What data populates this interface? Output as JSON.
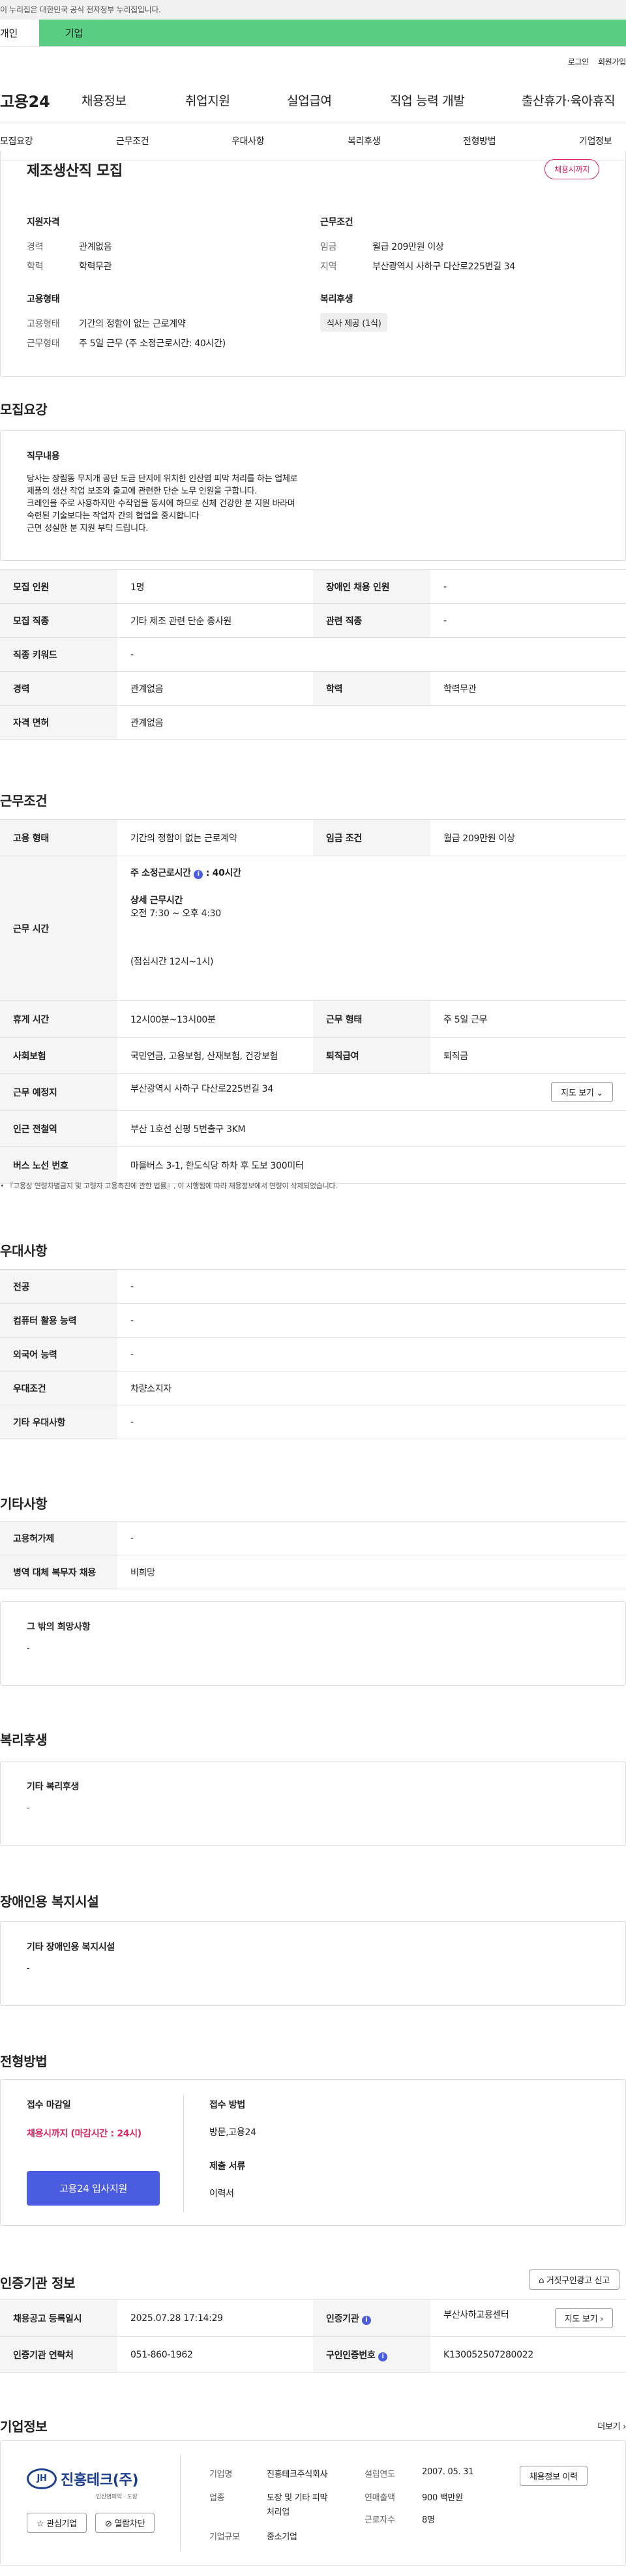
{
  "gov_banner": "이 누리집은 대한민국 공식 전자정부 누리집입니다.",
  "user_type": {
    "individual": "개인",
    "company": "기업"
  },
  "util": {
    "login": "로그인",
    "signup": "회원가입"
  },
  "logo": "고용24",
  "gnb": [
    "채용정보",
    "취업지원",
    "실업급여",
    "직업 능력 개발",
    "출산휴가·육아휴직"
  ],
  "tabs": [
    "모집요강",
    "근무조건",
    "우대사항",
    "복리후생",
    "전형방법",
    "기업정보"
  ],
  "summary": {
    "title": "제조생산직 모집",
    "badge": "채용시까지",
    "qual_title": "지원자격",
    "career_k": "경력",
    "career_v": "관계없음",
    "edu_k": "학력",
    "edu_v": "학력무관",
    "emp_title": "고용형태",
    "emp_k": "고용형태",
    "emp_v": "기간의 정함이 없는 근로계약",
    "work_k": "근무형태",
    "work_v": "주 5일 근무 (주 소정근로시간: 40시간)",
    "cond_title": "근무조건",
    "wage_k": "임금",
    "wage_v": "월급 209만원 이상",
    "region_k": "지역",
    "region_v": "부산광역시 사하구 다산로225번길 34",
    "welfare_title": "복리후생",
    "welfare_pill": "식사 제공 (1식)"
  },
  "recruit": {
    "title": "모집요강",
    "duty_title": "직무내용",
    "duty_lines": [
      "당사는 장림동 무지개 공단 도금 단지에 위치한 인산염 피막 처리를 하는 업체로",
      "제품의 생산 작업 보조와 출고에 관련한 단순 노무 인원을 구합니다.",
      "크레인을 주로 사용하지만 수작업을 동시에 하므로 신체 건강한 분 지원 바라며",
      "숙련된 기술보다는 작업자 간의 협업을 중시합니다",
      "근면 성실한 분 지원 부탁 드립니다."
    ],
    "rows": {
      "count_k": "모집 인원",
      "count_v": "1명",
      "disabled_k": "장애인 채용 인원",
      "disabled_v": "-",
      "job_k": "모집 직종",
      "job_v": "기타 제조 관련 단순 종사원",
      "related_k": "관련 직종",
      "related_v": "-",
      "keyword_k": "직종 키워드",
      "keyword_v": "-",
      "career_k": "경력",
      "career_v": "관계없음",
      "edu_k": "학력",
      "edu_v": "학력무관",
      "license_k": "자격 면허",
      "license_v": "관계없음"
    }
  },
  "conditions": {
    "title": "근무조건",
    "emp_k": "고용 형태",
    "emp_v": "기간의 정함이 없는 근로계약",
    "wage_k": "임금 조건",
    "wage_v": "월급 209만원 이상",
    "hours_k": "근무 시간",
    "hours_main": "주 소정근로시간",
    "hours_main_v": ": 40시간",
    "hours_detail_t": "상세 근무시간",
    "hours_detail_v": "오전 7:30 ~ 오후 4:30",
    "hours_break": "(점심시간 12시~1시)",
    "rest_k": "휴게 시간",
    "rest_v": "12시00분~13시00분",
    "worktype_k": "근무 형태",
    "worktype_v": "주 5일 근무",
    "insurance_k": "사회보험",
    "insurance_v": "국민연금, 고용보험, 산재보험, 건강보험",
    "severance_k": "퇴직급여",
    "severance_v": "퇴직금",
    "location_k": "근무 예정지",
    "location_v": "부산광역시 사하구 다산로225번길 34",
    "map_btn": "지도 보기",
    "subway_k": "인근 전철역",
    "subway_v": "부산 1호선 신평 5번출구 3KM",
    "bus_k": "버스 노선 번호",
    "bus_v": "마을버스 3-1, 한도식당 하차 후 도보 300미터",
    "notice": "『고용상 연령차별금지 및 고령자 고용촉진에 관한 법률』, 이 시행됨에 따라 채용정보에서 연령이 삭제되었습니다."
  },
  "preference": {
    "title": "우대사항",
    "major_k": "전공",
    "major_v": "-",
    "pc_k": "컴퓨터 활용 능력",
    "pc_v": "-",
    "lang_k": "외국어 능력",
    "lang_v": "-",
    "cond_k": "우대조건",
    "cond_v": "차량소지자",
    "etc_k": "기타 우대사항",
    "etc_v": "-"
  },
  "etc": {
    "title": "기타사항",
    "permit_k": "고용허가제",
    "permit_v": "-",
    "military_k": "병역 대체 복무자 채용",
    "military_v": "비희망",
    "other_t": "그 밖의 희망사항",
    "other_v": "-"
  },
  "welfare": {
    "title": "복리후생",
    "box_t": "기타 복리후생",
    "box_v": "-"
  },
  "disabled_fac": {
    "title": "장애인용 복지시설",
    "box_t": "기타 장애인용 복지시설",
    "box_v": "-"
  },
  "selection": {
    "title": "전형방법",
    "deadline_t": "접수 마감일",
    "deadline_v": "채용시까지 (마감시간 : 24시)",
    "apply_btn": "고용24 입사지원",
    "method_t": "접수 방법",
    "method_v": "방문,고용24",
    "docs_t": "제출 서류",
    "docs_v": "이력서"
  },
  "cert": {
    "title": "인증기관 정보",
    "report_btn": "거짓구인광고 신고",
    "reg_k": "채용공고 등록일시",
    "reg_v": "2025.07.28 17:14:29",
    "org_k": "인증기관",
    "org_v": "부산사하고용센터",
    "map_btn": "지도 보기",
    "tel_k": "인증기관 연락처",
    "tel_v": "051-860-1962",
    "no_k": "구인인증번호",
    "no_v": "K130052507280022"
  },
  "company": {
    "title": "기업정보",
    "more": "더보기",
    "logo_mark": "JH",
    "logo_name": "진흥테크(주)",
    "logo_sub": "인산염피막 · 도장",
    "interest_btn": "관심기업",
    "block_btn": "열람차단",
    "name_k": "기업명",
    "name_v": "진흥테크주식회사",
    "biz_k": "업종",
    "biz_v1": "도장 및 기타 피막",
    "biz_v2": "처리업",
    "size_k": "기업규모",
    "size_v": "중소기업",
    "est_k": "설립연도",
    "est_v": "2007. 05. 31",
    "sales_k": "연매출액",
    "sales_v": "900 백만원",
    "emp_k": "근로자수",
    "emp_v": "8명",
    "history_btn": "채용정보 이력"
  }
}
